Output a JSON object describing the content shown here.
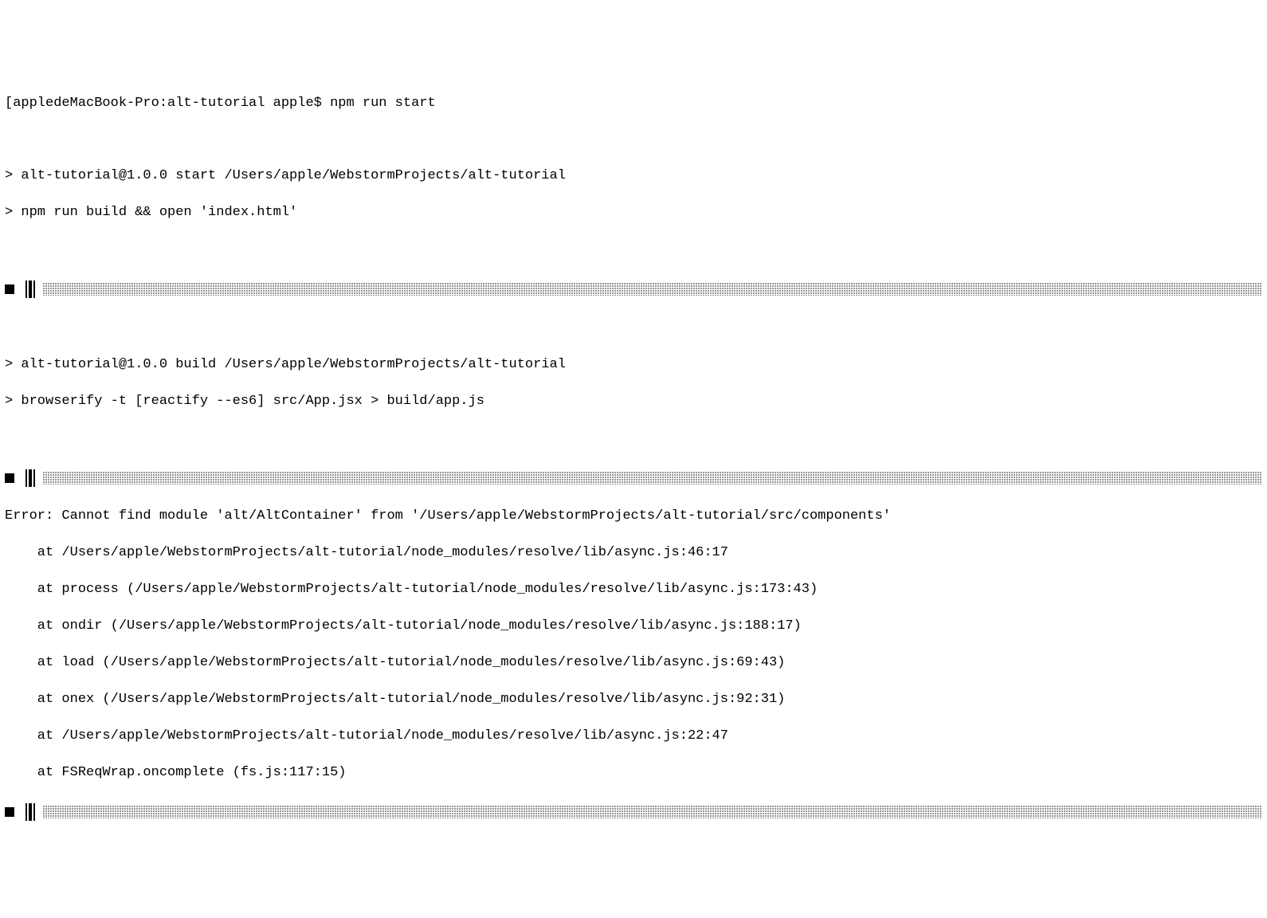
{
  "terminal": {
    "prompt_line": "[appledeMacBook-Pro:alt-tutorial apple$ npm run start",
    "blank1": "",
    "start_header": "> alt-tutorial@1.0.0 start /Users/apple/WebstormProjects/alt-tutorial",
    "start_cmd": "> npm run build && open 'index.html'",
    "blank2": "",
    "build_header": "> alt-tutorial@1.0.0 build /Users/apple/WebstormProjects/alt-tutorial",
    "build_cmd": "> browserify -t [reactify --es6] src/App.jsx > build/app.js",
    "blank3": "",
    "error_line": "Error: Cannot find module 'alt/AltContainer' from '/Users/apple/WebstormProjects/alt-tutorial/src/components'",
    "stack1": "    at /Users/apple/WebstormProjects/alt-tutorial/node_modules/resolve/lib/async.js:46:17",
    "stack2": "    at process (/Users/apple/WebstormProjects/alt-tutorial/node_modules/resolve/lib/async.js:173:43)",
    "stack3": "    at ondir (/Users/apple/WebstormProjects/alt-tutorial/node_modules/resolve/lib/async.js:188:17)",
    "stack4": "    at load (/Users/apple/WebstormProjects/alt-tutorial/node_modules/resolve/lib/async.js:69:43)",
    "stack5": "    at onex (/Users/apple/WebstormProjects/alt-tutorial/node_modules/resolve/lib/async.js:92:31)",
    "stack6": "    at /Users/apple/WebstormProjects/alt-tutorial/node_modules/resolve/lib/async.js:22:47",
    "stack7": "    at FSReqWrap.oncomplete (fs.js:117:15)"
  }
}
